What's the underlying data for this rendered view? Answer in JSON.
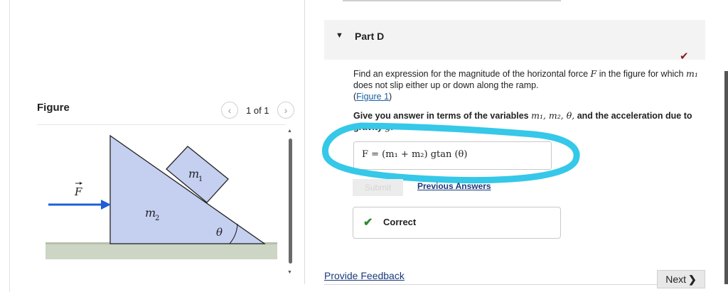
{
  "figure_panel": {
    "title": "Figure",
    "prev_icon": "chevron-left-icon",
    "next_icon": "chevron-right-icon",
    "pager_text": "1 of 1",
    "diagram": {
      "force_label": "F",
      "mass_block_label": "m",
      "mass_block_sub": "1",
      "mass_wedge_label": "m",
      "mass_wedge_sub": "2",
      "angle_label": "θ"
    }
  },
  "part": {
    "title": "Part D",
    "status_icon": "checkmark-icon",
    "question_pre": "Find an expression for the magnitude of the horizontal force ",
    "question_var": "F",
    "question_mid": " in the figure for which ",
    "question_var2": "m₁",
    "question_post": " does not slip either up or down along the ramp.",
    "figure_link": "Figure 1",
    "instruction_pre": "Give you answer in terms of the variables ",
    "instruction_vars": "m₁, m₂, θ,",
    "instruction_mid": " and the acceleration due to gravity ",
    "instruction_g": "g",
    "instruction_end": ".",
    "answer": "F =  (m₁ + m₂) gtan (θ)",
    "submit_label": "Submit",
    "previous_answers_label": "Previous Answers",
    "result_icon": "checkmark-icon",
    "result_label": "Correct"
  },
  "footer": {
    "feedback_label": "Provide Feedback",
    "next_label": "Next",
    "next_icon": "chevron-right-icon"
  },
  "colors": {
    "annotation_stroke": "#35c8e8",
    "wedge_fill": "#c5cff0",
    "force_arrow": "#1f5fd6",
    "correct_green": "#2e8b2e",
    "status_check": "#8b1a1a"
  }
}
